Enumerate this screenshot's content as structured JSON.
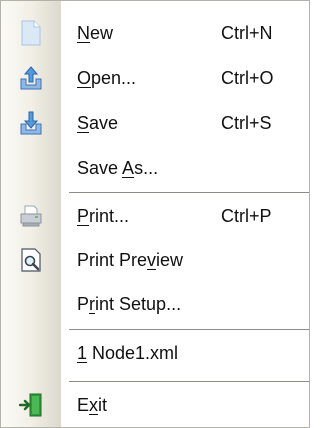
{
  "menu": {
    "items": [
      {
        "pre": "",
        "key": "N",
        "post": "ew",
        "shortcut": "Ctrl+N",
        "icon": "new-document-icon"
      },
      {
        "pre": "",
        "key": "O",
        "post": "pen...",
        "shortcut": "Ctrl+O",
        "icon": "open-folder-icon"
      },
      {
        "pre": "",
        "key": "S",
        "post": "ave",
        "shortcut": "Ctrl+S",
        "icon": "save-icon"
      },
      {
        "pre": "Save ",
        "key": "A",
        "post": "s...",
        "shortcut": "",
        "icon": ""
      },
      {
        "pre": "",
        "key": "P",
        "post": "rint...",
        "shortcut": "Ctrl+P",
        "icon": "printer-icon"
      },
      {
        "pre": "Print Pre",
        "key": "v",
        "post": "iew",
        "shortcut": "",
        "icon": "print-preview-icon"
      },
      {
        "pre": "P",
        "key": "r",
        "post": "int Setup...",
        "shortcut": "",
        "icon": ""
      },
      {
        "pre": "",
        "key": "1",
        "post": " Node1.xml",
        "shortcut": "",
        "icon": ""
      },
      {
        "pre": "E",
        "key": "x",
        "post": "it",
        "shortcut": "",
        "icon": "exit-icon"
      }
    ]
  }
}
